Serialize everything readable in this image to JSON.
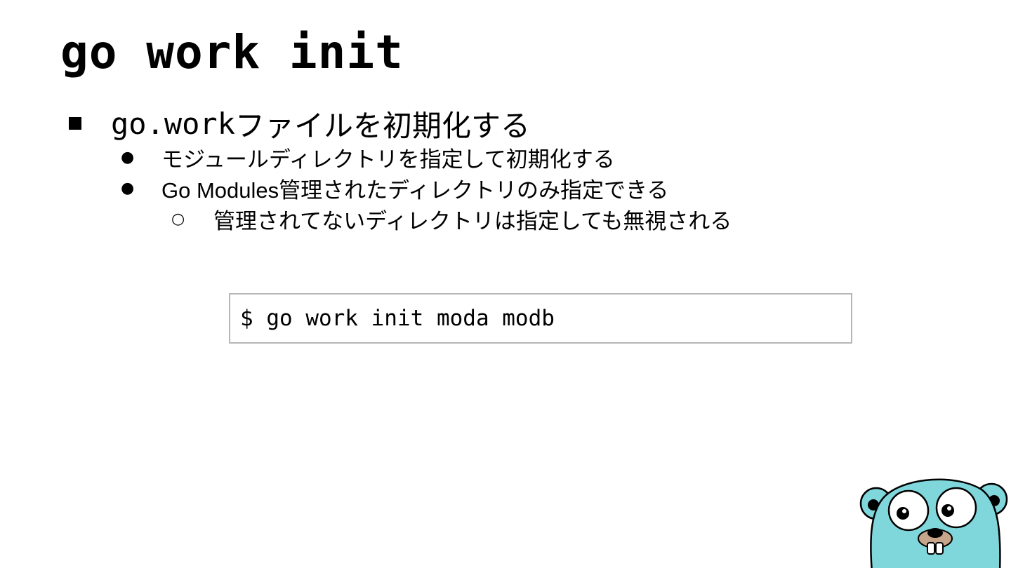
{
  "slide": {
    "title": "go work init",
    "bullets": {
      "level1": {
        "mono": "go.work",
        "text": "ファイルを初期化する"
      },
      "level2": [
        {
          "marker": "●",
          "text": "モジュールディレクトリを指定して初期化する"
        },
        {
          "marker": "●",
          "text": "Go Modules管理されたディレクトリのみ指定できる"
        }
      ],
      "level3": [
        {
          "marker": "○",
          "text": "管理されてないディレクトリは指定しても無視される"
        }
      ]
    },
    "code": "$ go work init moda modb",
    "mascot": "gopher-mascot-icon",
    "colors": {
      "background": "#ffffff",
      "text": "#000000",
      "code_border": "#b7b7b7",
      "gopher_body": "#7fd7dc",
      "gopher_nose": "#c7a58a"
    }
  }
}
